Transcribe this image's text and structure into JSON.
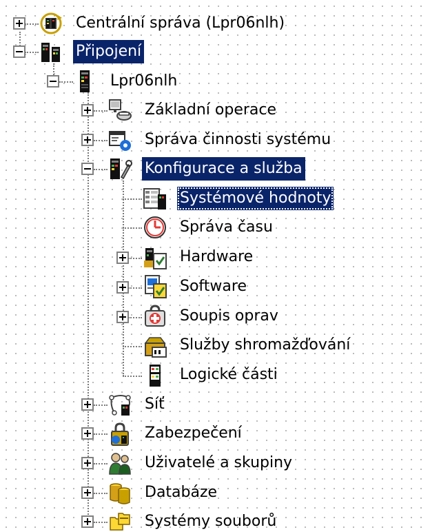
{
  "tree": {
    "items": [
      {
        "label": "Centrální správa (Lpr06nlh)",
        "icon": "central-management-icon",
        "expander": "collapsed"
      },
      {
        "label": "Připojení",
        "icon": "connections-icon",
        "expander": "expanded",
        "state": "selected"
      },
      {
        "label": "Lpr06nlh",
        "icon": "system-icon",
        "expander": "expanded"
      },
      {
        "label": "Základní operace",
        "icon": "basic-operations-icon",
        "expander": "collapsed"
      },
      {
        "label": "Správa činnosti systému",
        "icon": "work-management-icon",
        "expander": "collapsed"
      },
      {
        "label": "Konfigurace a služba",
        "icon": "configuration-service-icon",
        "expander": "expanded",
        "state": "selected"
      },
      {
        "label": "Systémové hodnoty",
        "icon": "system-values-icon",
        "expander": "none",
        "state": "selected-focused"
      },
      {
        "label": "Správa času",
        "icon": "clock-icon",
        "expander": "none"
      },
      {
        "label": "Hardware",
        "icon": "hardware-icon",
        "expander": "collapsed"
      },
      {
        "label": "Software",
        "icon": "software-icon",
        "expander": "collapsed"
      },
      {
        "label": "Soupis oprav",
        "icon": "fixes-inventory-icon",
        "expander": "collapsed"
      },
      {
        "label": "Služby shromažďování",
        "icon": "collection-services-icon",
        "expander": "none"
      },
      {
        "label": "Logické části",
        "icon": "logical-partitions-icon",
        "expander": "none"
      },
      {
        "label": "Síť",
        "icon": "network-icon",
        "expander": "collapsed"
      },
      {
        "label": "Zabezpečení",
        "icon": "security-icon",
        "expander": "collapsed"
      },
      {
        "label": "Uživatelé a skupiny",
        "icon": "users-groups-icon",
        "expander": "collapsed"
      },
      {
        "label": "Databáze",
        "icon": "database-icon",
        "expander": "collapsed"
      },
      {
        "label": "Systémy souborů",
        "icon": "file-systems-icon",
        "expander": "collapsed"
      }
    ]
  },
  "colors": {
    "selection_background": "#0a246a",
    "selection_text": "#ffffff"
  }
}
